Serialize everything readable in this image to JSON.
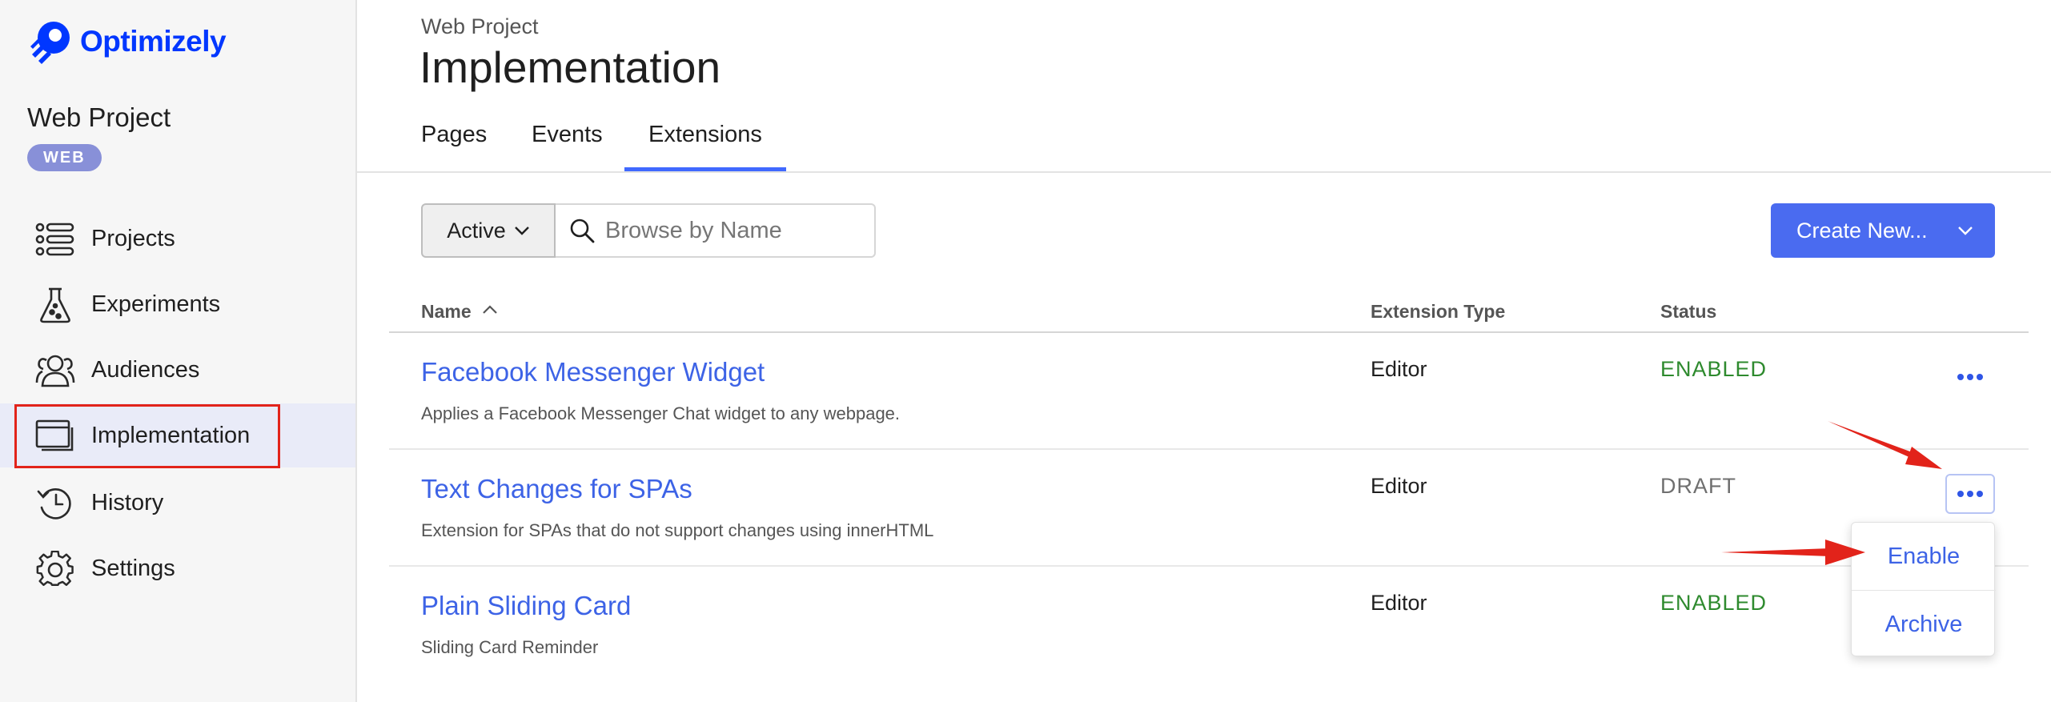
{
  "brand": {
    "name": "Optimizely",
    "color": "#0037ff"
  },
  "sidebar": {
    "project_name": "Web Project",
    "project_badge": "WEB",
    "items": [
      {
        "label": "Projects",
        "icon": "list-icon"
      },
      {
        "label": "Experiments",
        "icon": "flask-icon"
      },
      {
        "label": "Audiences",
        "icon": "people-icon"
      },
      {
        "label": "Implementation",
        "icon": "window-icon",
        "active": true
      },
      {
        "label": "History",
        "icon": "history-icon"
      },
      {
        "label": "Settings",
        "icon": "gear-icon"
      }
    ]
  },
  "header": {
    "breadcrumb": "Web Project",
    "title": "Implementation",
    "tabs": [
      {
        "label": "Pages"
      },
      {
        "label": "Events"
      },
      {
        "label": "Extensions",
        "active": true
      }
    ]
  },
  "toolbar": {
    "filter_value": "Active",
    "search_placeholder": "Browse by Name",
    "create_label": "Create New..."
  },
  "table": {
    "columns": [
      "Name",
      "Extension Type",
      "Status"
    ],
    "rows": [
      {
        "title": "Facebook Messenger Widget",
        "description": "Applies a Facebook Messenger Chat widget to any webpage.",
        "type": "Editor",
        "status": "ENABLED"
      },
      {
        "title": "Text Changes for SPAs",
        "description": "Extension for SPAs that do not support changes using innerHTML",
        "type": "Editor",
        "status": "DRAFT"
      },
      {
        "title": "Plain Sliding Card",
        "description": "Sliding Card Reminder",
        "type": "Editor",
        "status": "ENABLED"
      }
    ]
  },
  "row_menu": {
    "items": [
      "Enable",
      "Archive"
    ]
  },
  "colors": {
    "accent": "#4a6bf0",
    "link": "#3d63e6",
    "enabled": "#2e8a2e",
    "draft": "#6f6f6f",
    "annotation": "#e2231a"
  }
}
